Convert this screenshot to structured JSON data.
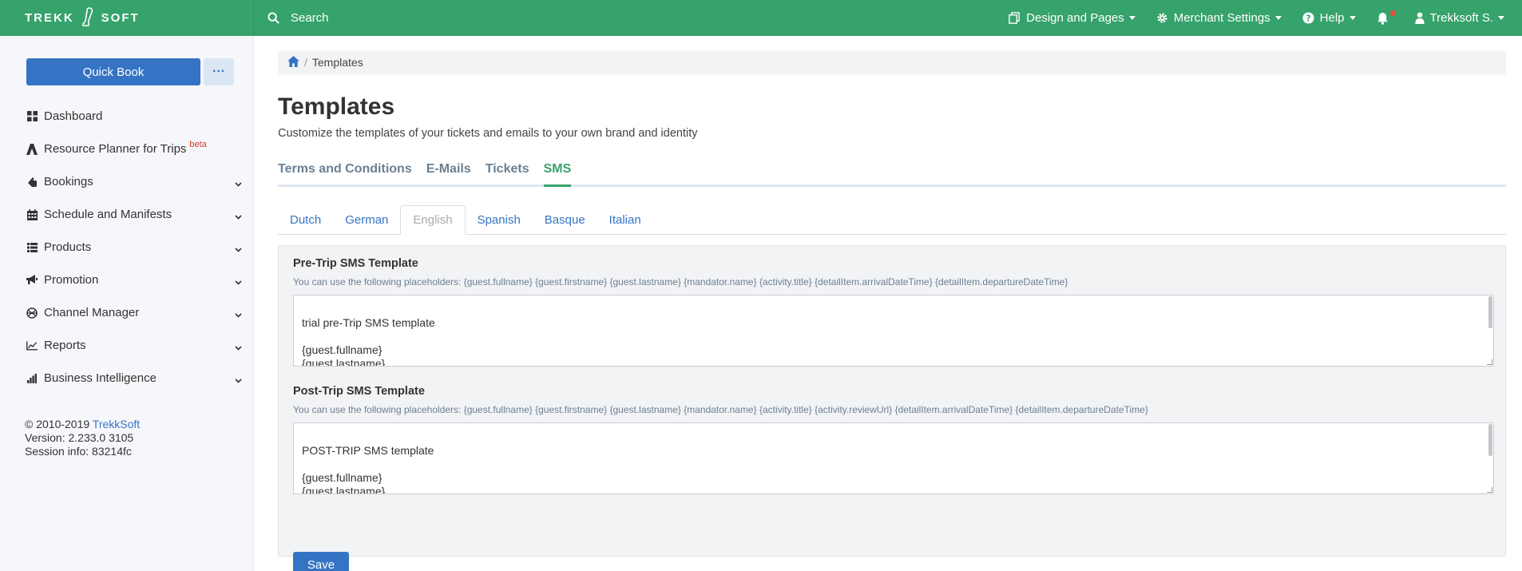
{
  "brand": {
    "left": "TREKK",
    "right": "SOFT"
  },
  "topbar": {
    "search_label": "Search",
    "design_pages": "Design and Pages",
    "merchant_settings": "Merchant Settings",
    "help": "Help",
    "user": "Trekksoft S."
  },
  "sidebar": {
    "quick_book": "Quick Book",
    "more_label": "···",
    "items": [
      {
        "label": "Dashboard",
        "icon": "grid-icon",
        "expandable": false
      },
      {
        "label": "Resource Planner for Trips",
        "icon": "tent-icon",
        "expandable": false,
        "badge": "beta"
      },
      {
        "label": "Bookings",
        "icon": "tag-icon",
        "expandable": true
      },
      {
        "label": "Schedule and Manifests",
        "icon": "calendar-icon",
        "expandable": true
      },
      {
        "label": "Products",
        "icon": "list-icon",
        "expandable": true
      },
      {
        "label": "Promotion",
        "icon": "megaphone-icon",
        "expandable": true
      },
      {
        "label": "Channel Manager",
        "icon": "network-icon",
        "expandable": true
      },
      {
        "label": "Reports",
        "icon": "line-chart-icon",
        "expandable": true
      },
      {
        "label": "Business Intelligence",
        "icon": "bar-chart-icon",
        "expandable": true
      }
    ],
    "footer": {
      "copyright": "© 2010-2019 ",
      "company_link": "TrekkSoft",
      "version": "Version: 2.233.0 3105",
      "session": "Session info: 83214fc"
    }
  },
  "main": {
    "breadcrumb": {
      "current": "Templates",
      "separator": "/"
    },
    "title": "Templates",
    "subtitle": "Customize the templates of your tickets and emails to your own brand and identity",
    "tabs": [
      {
        "label": "Terms and Conditions",
        "active": false
      },
      {
        "label": "E-Mails",
        "active": false
      },
      {
        "label": "Tickets",
        "active": false
      },
      {
        "label": "SMS",
        "active": true
      }
    ],
    "languages": [
      {
        "label": "Dutch",
        "active": false
      },
      {
        "label": "German",
        "active": false
      },
      {
        "label": "English",
        "active": true
      },
      {
        "label": "Spanish",
        "active": false
      },
      {
        "label": "Basque",
        "active": false
      },
      {
        "label": "Italian",
        "active": false
      }
    ],
    "pre_trip": {
      "label": "Pre-Trip SMS Template",
      "help": "You can use the following placeholders: {guest.fullname} {guest.firstname} {guest.lastname} {mandator.name} {activity.title} {detailItem.arrivalDateTime} {detailItem.departureDateTime}",
      "value": "trial pre-Trip SMS template\n\n{guest.fullname}\n{guest.lastname}\n{mandator.name}"
    },
    "post_trip": {
      "label": "Post-Trip SMS Template",
      "help": "You can use the following placeholders: {guest.fullname} {guest.firstname} {guest.lastname} {mandator.name} {activity.title} {activity.reviewUrl} {detailItem.arrivalDateTime} {detailItem.departureDateTime}",
      "value": "POST-TRIP SMS template\n\n{guest.fullname}\n{guest.lastname}\n{mandator.name}"
    },
    "save_label": "Save"
  },
  "colors": {
    "brand_green": "#36a26c",
    "primary_blue": "#3574c4",
    "badge_red": "#d0382b"
  }
}
